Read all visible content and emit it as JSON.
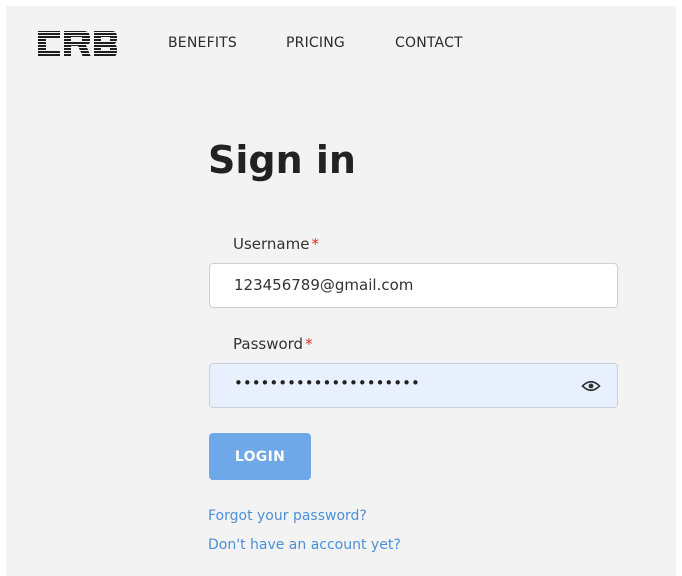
{
  "header": {
    "logo_text": "CRB",
    "nav": [
      {
        "label": "BENEFITS"
      },
      {
        "label": "PRICING"
      },
      {
        "label": "CONTACT"
      }
    ]
  },
  "form": {
    "title": "Sign in",
    "username": {
      "label": "Username",
      "required_mark": "*",
      "value": "123456789@gmail.com"
    },
    "password": {
      "label": "Password",
      "required_mark": "*",
      "value_masked": "•••••••••••••••••••••",
      "icon": "eye-icon"
    },
    "login_label": "LOGIN",
    "forgot_link": "Forgot your password?",
    "signup_link": "Don't have an account yet?"
  },
  "colors": {
    "background": "#f3f3f3",
    "accent_button": "#6ea8e8",
    "link": "#4a90d9",
    "required": "#d93025",
    "autofill_bg": "#e8f0fe"
  }
}
